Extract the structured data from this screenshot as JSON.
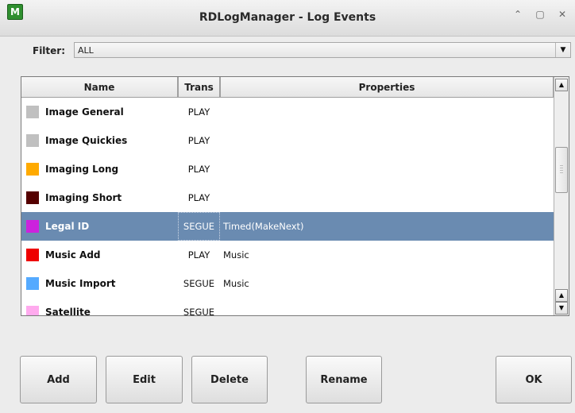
{
  "window": {
    "title": "RDLogManager - Log Events",
    "app_icon_glyph": "M",
    "controls": [
      "⌃",
      "▢",
      "✕"
    ]
  },
  "filter": {
    "label": "Filter:",
    "value": "ALL"
  },
  "table": {
    "columns": {
      "name": "Name",
      "trans": "Trans",
      "properties": "Properties"
    },
    "rows": [
      {
        "name": "Image General",
        "trans": "PLAY",
        "properties": "",
        "color": "#c0c0c0"
      },
      {
        "name": "Image Quickies",
        "trans": "PLAY",
        "properties": "",
        "color": "#c0c0c0"
      },
      {
        "name": "Imaging Long",
        "trans": "PLAY",
        "properties": "",
        "color": "#ffaa00"
      },
      {
        "name": "Imaging Short",
        "trans": "PLAY",
        "properties": "",
        "color": "#550000"
      },
      {
        "name": "Legal ID",
        "trans": "SEGUE",
        "properties": "Timed(MakeNext)",
        "color": "#cc22dd",
        "selected": true
      },
      {
        "name": "Music Add",
        "trans": "PLAY",
        "properties": "Music",
        "color": "#ee0000"
      },
      {
        "name": "Music Import",
        "trans": "SEGUE",
        "properties": "Music",
        "color": "#55aaff"
      },
      {
        "name": "Satellite",
        "trans": "SEGUE",
        "properties": "",
        "color": "#ffaaee"
      },
      {
        "name": "",
        "trans": "",
        "properties": "",
        "color": "#cc22dd"
      }
    ],
    "selected_row_color": "#6a8bb1"
  },
  "buttons": {
    "add": "Add",
    "edit": "Edit",
    "delete": "Delete",
    "rename": "Rename",
    "ok": "OK"
  }
}
